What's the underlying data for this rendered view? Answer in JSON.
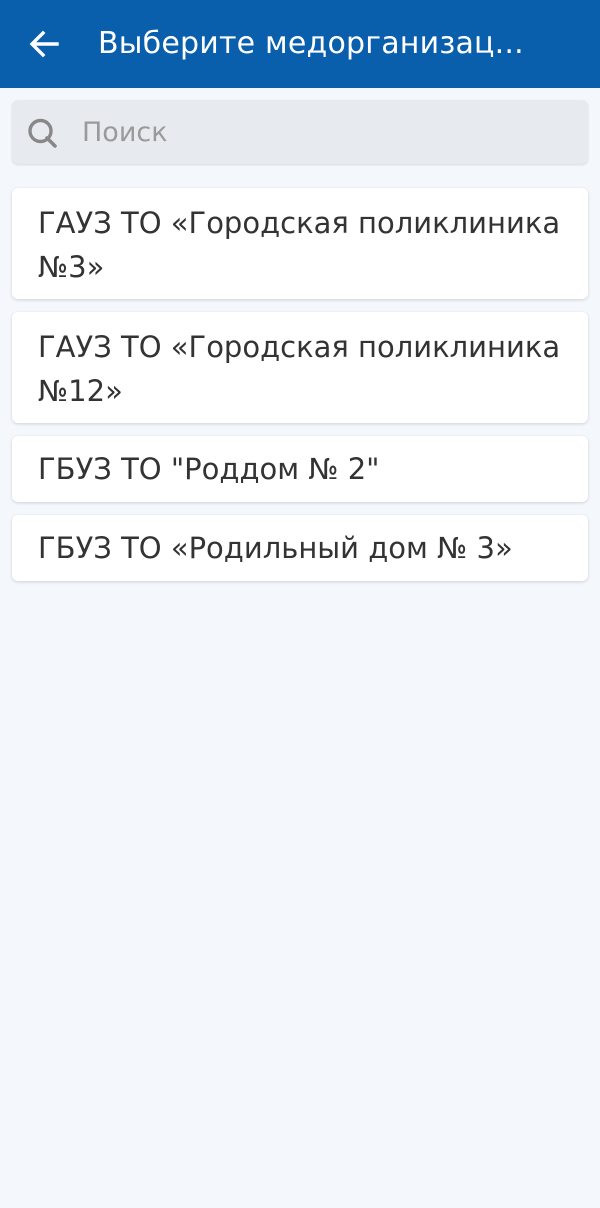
{
  "header": {
    "title": "Выберите медорганизац...",
    "background": "#0a5fad"
  },
  "search": {
    "placeholder": "Поиск",
    "value": ""
  },
  "organizations": [
    {
      "label": "ГАУЗ ТО «Городская поликлиника №3»"
    },
    {
      "label": "ГАУЗ ТО «Городская поликлиника №12»"
    },
    {
      "label": "ГБУЗ ТО \"Роддом № 2\""
    },
    {
      "label": "ГБУЗ ТО «Родильный дом № 3»"
    }
  ],
  "icons": {
    "back": "arrow-left-icon",
    "search": "search-icon"
  }
}
